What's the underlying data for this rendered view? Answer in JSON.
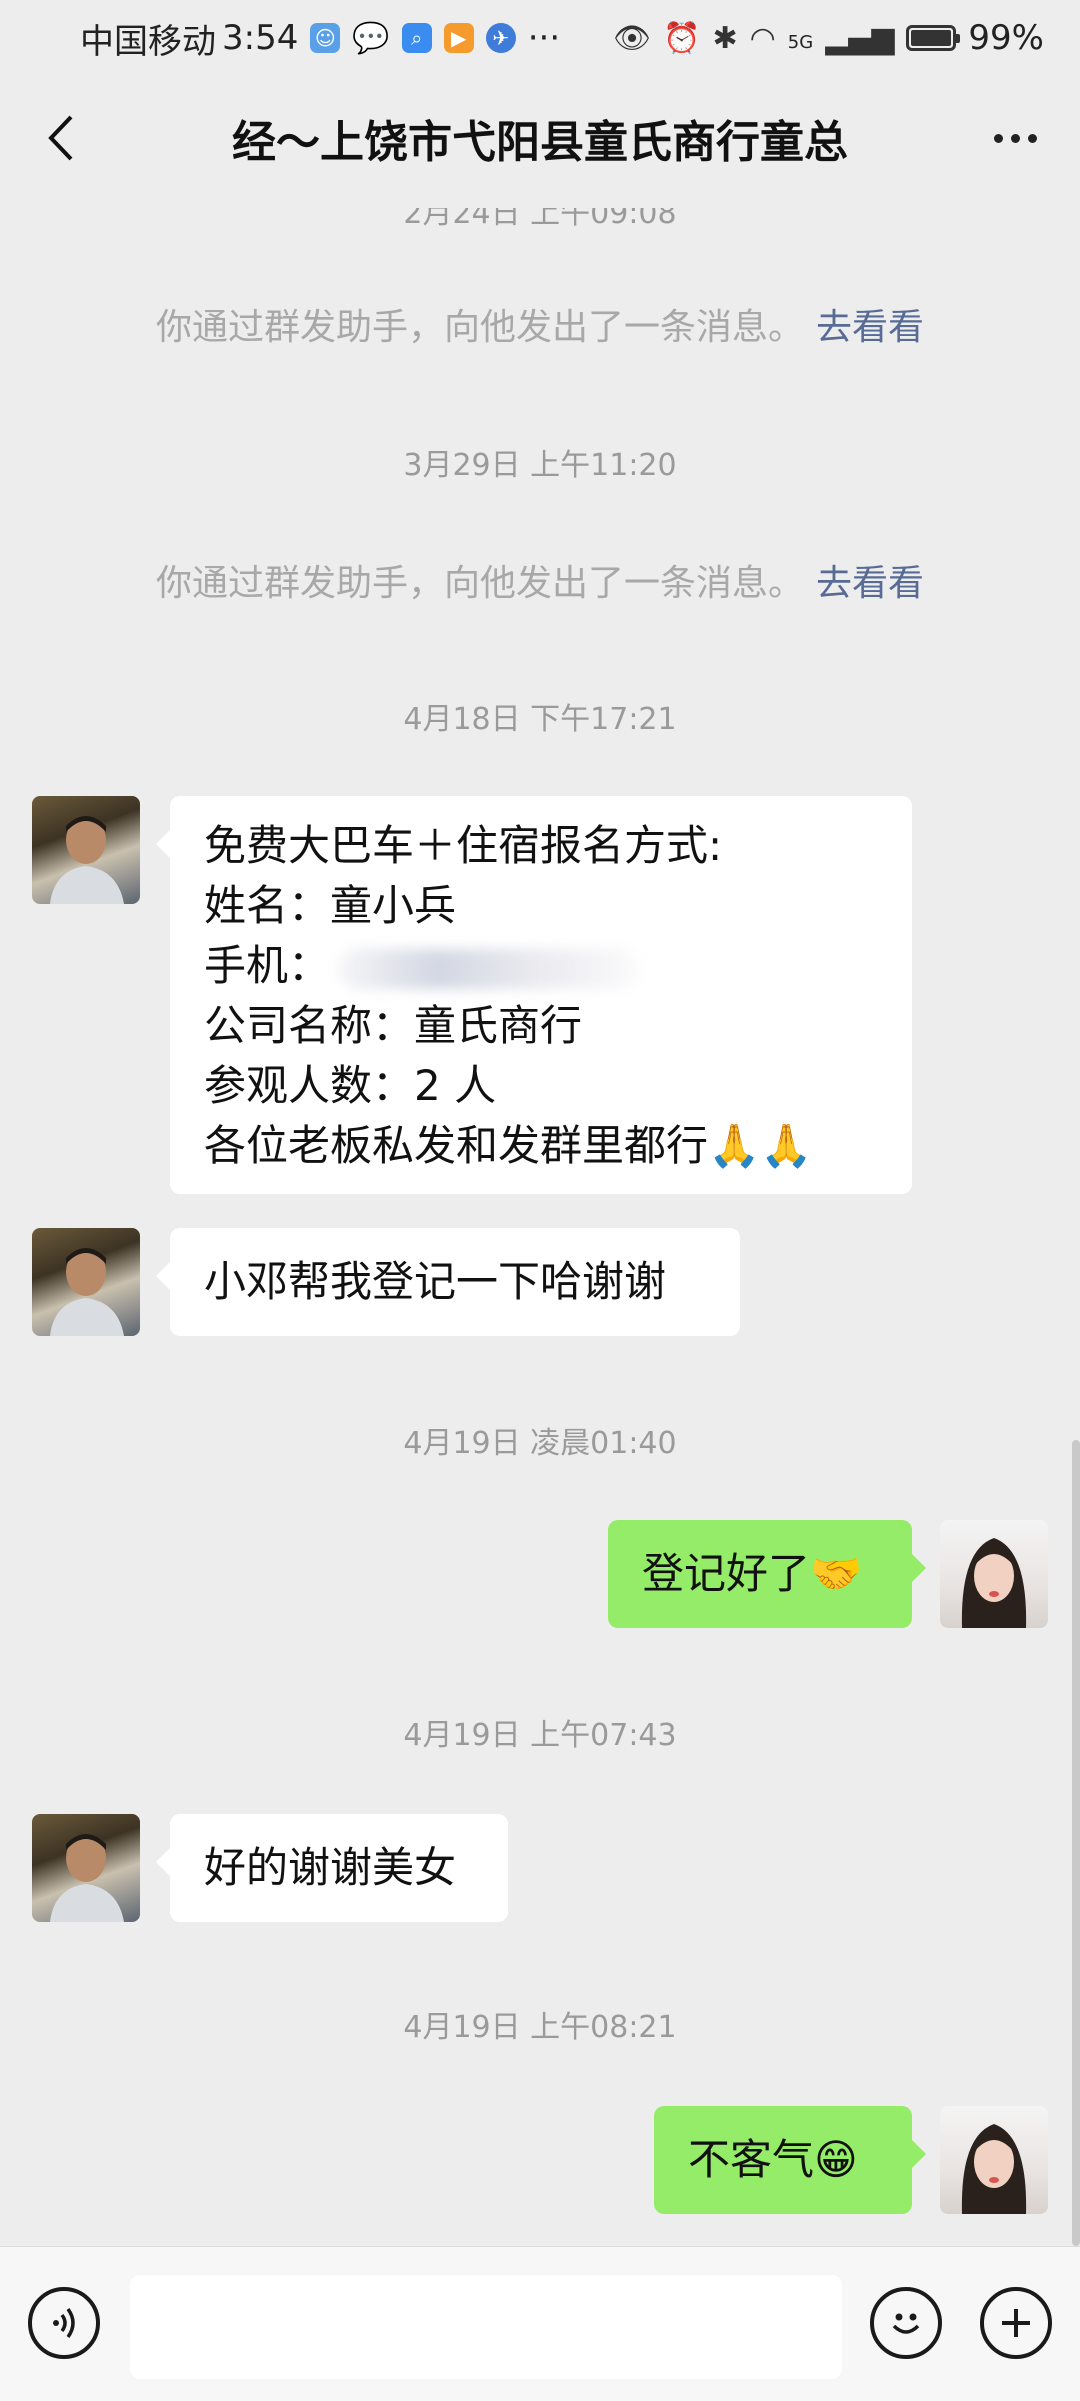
{
  "status_bar": {
    "carrier": "中国移动",
    "time": "3:54",
    "battery": "99%",
    "signal_label": "5G",
    "more": "···"
  },
  "header": {
    "title": "经～上饶市弋阳县童氏商行童总"
  },
  "chat": {
    "timestamps": [
      "2月24日 上午09:08",
      "3月29日 上午11:20",
      "4月18日 下午17:21",
      "4月19日 凌晨01:40",
      "4月19日 上午07:43",
      "4月19日 上午08:21"
    ],
    "system_messages": [
      {
        "text": "你通过群发助手，向他发出了一条消息。",
        "link": "去看看"
      },
      {
        "text": "你通过群发助手，向他发出了一条消息。",
        "link": "去看看"
      }
    ],
    "messages": [
      {
        "sender": "incoming",
        "lines": [
          "免费大巴车＋住宿报名方式:",
          "姓名：童小兵",
          "手机：",
          "公司名称：童氏商行",
          "参观人数：2 人",
          "各位老板私发和发群里都行🙏🙏"
        ]
      },
      {
        "sender": "incoming",
        "text": "小邓帮我登记一下哈谢谢"
      },
      {
        "sender": "outgoing",
        "text": "登记好了🤝"
      },
      {
        "sender": "incoming",
        "text": "好的谢谢美女"
      },
      {
        "sender": "outgoing",
        "text": "不客气😁"
      }
    ]
  },
  "input_bar": {
    "placeholder": "",
    "icons": [
      "voice-icon",
      "emoji-icon",
      "plus-icon"
    ]
  },
  "colors": {
    "background": "#ededed",
    "incoming_bubble": "#ffffff",
    "outgoing_bubble": "#95ec69",
    "link": "#576b95"
  }
}
